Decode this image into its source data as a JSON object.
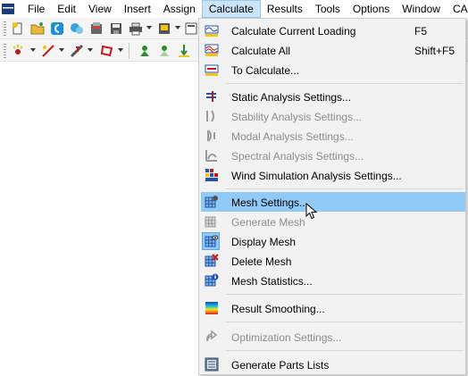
{
  "menubar": {
    "items": [
      {
        "label": "File"
      },
      {
        "label": "Edit"
      },
      {
        "label": "View"
      },
      {
        "label": "Insert"
      },
      {
        "label": "Assign"
      },
      {
        "label": "Calculate",
        "active": true
      },
      {
        "label": "Results"
      },
      {
        "label": "Tools"
      },
      {
        "label": "Options"
      },
      {
        "label": "Window"
      },
      {
        "label": "CAD"
      }
    ]
  },
  "calculate_menu": {
    "calc_current": {
      "label": "Calculate Current Loading",
      "shortcut": "F5"
    },
    "calc_all": {
      "label": "Calculate All",
      "shortcut": "Shift+F5"
    },
    "to_calculate": {
      "label": "To Calculate..."
    },
    "static_settings": {
      "label": "Static Analysis Settings..."
    },
    "stability_settings": {
      "label": "Stability Analysis Settings...",
      "disabled": true
    },
    "modal_settings": {
      "label": "Modal Analysis Settings...",
      "disabled": true
    },
    "spectral_settings": {
      "label": "Spectral Analysis Settings...",
      "disabled": true
    },
    "wind_settings": {
      "label": "Wind Simulation Analysis Settings..."
    },
    "mesh_settings": {
      "label": "Mesh Settings...",
      "highlighted": true
    },
    "generate_mesh": {
      "label": "Generate Mesh",
      "disabled": true
    },
    "display_mesh": {
      "label": "Display Mesh",
      "checked": true
    },
    "delete_mesh": {
      "label": "Delete Mesh"
    },
    "mesh_statistics": {
      "label": "Mesh Statistics..."
    },
    "result_smoothing": {
      "label": "Result Smoothing..."
    },
    "optimization_settings": {
      "label": "Optimization Settings...",
      "disabled": true
    },
    "generate_parts_lists": {
      "label": "Generate Parts Lists"
    }
  },
  "colors": {
    "menu_background": "#f2f2f2",
    "highlight": "#91c9f7",
    "active_menubar": "#cce4f7",
    "disabled_text": "#8d8d8d"
  }
}
